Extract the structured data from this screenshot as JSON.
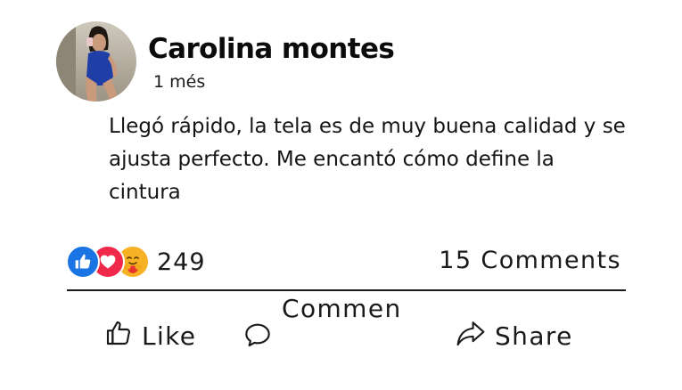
{
  "post": {
    "author": "Carolina montes",
    "time": "1 més",
    "text": "Llegó rápido, la tela es de muy buena calidad y se ajusta perfecto. Me encantó cómo define la cintura"
  },
  "stats": {
    "reaction_icons": [
      "like-icon",
      "love-icon",
      "care-icon"
    ],
    "reactions_count": "249",
    "comments_label": "15 Comments"
  },
  "actions": {
    "like": "Like",
    "comment": "Commen",
    "share": "Share"
  },
  "colors": {
    "like_blue": "#1b74e4",
    "love_red": "#f0284a",
    "care_yellow": "#f7b125",
    "text": "#1a1a1a"
  }
}
